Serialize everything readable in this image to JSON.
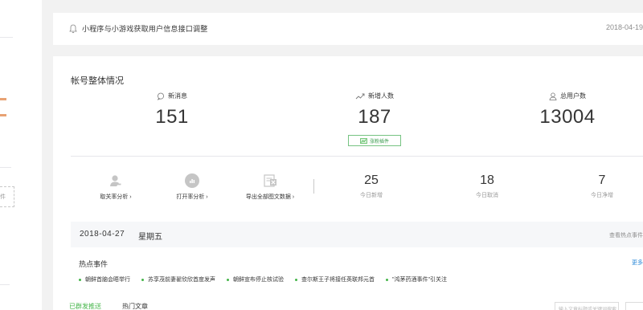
{
  "sidebar": {
    "partial_label": "件"
  },
  "notice": {
    "message": "小程序与小游戏获取用户信息接口调整",
    "date": "2018-04-19"
  },
  "account": {
    "title": "帐号整体情况",
    "stats": [
      {
        "label": "新消息",
        "value": "151",
        "icon": "chat-bubble-icon"
      },
      {
        "label": "新增人数",
        "value": "187",
        "icon": "trend-line-icon"
      },
      {
        "label": "总用户数",
        "value": "13004",
        "icon": "user-icon"
      }
    ],
    "fans_button": "涨粉插件"
  },
  "tools": [
    {
      "label": "取关率分析 ›",
      "icon": "user-unfollow-icon"
    },
    {
      "label": "打开率分析 ›",
      "icon": "chart-circle-icon"
    },
    {
      "label": "导出全部图文数据 ›",
      "icon": "excel-icon"
    }
  ],
  "today": [
    {
      "value": "25",
      "label": "今日新增"
    },
    {
      "value": "18",
      "label": "今日取消"
    },
    {
      "value": "7",
      "label": "今日净增"
    }
  ],
  "date_band": {
    "date": "2018-04-27",
    "weekday": "星期五",
    "more": "查看热点事件"
  },
  "hot_events": {
    "title": "热点事件",
    "more": "更多",
    "items": [
      "朝鲜首脑会晤举行",
      "苏享茂前妻翟欣欣首度发声",
      "朝鲜宣布停止核试验",
      "查尔斯王子将接任英联邦元首",
      "\"鸿茅药酒事件\"引关注"
    ]
  },
  "tabs": [
    {
      "label": "已群发推送",
      "active": true
    },
    {
      "label": "热门文章",
      "active": false
    }
  ],
  "search": {
    "placeholder": "输入文章标题或关键词搜索"
  },
  "colors": {
    "accent_green": "#44b549",
    "link_blue": "#2e8ad8",
    "sidebar_tag": "#e8a273"
  }
}
